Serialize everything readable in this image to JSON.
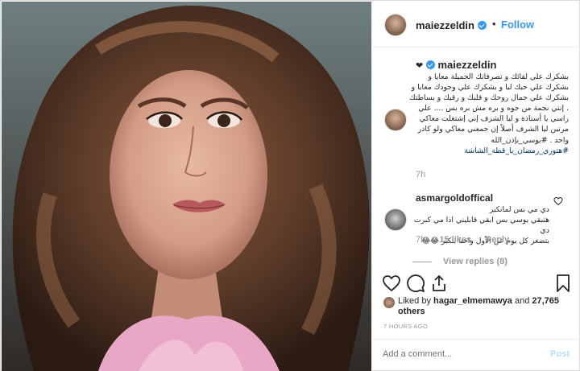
{
  "post": {
    "username": "maiezzeldin",
    "follow_label": "Follow",
    "separator": "•"
  },
  "caption": {
    "username": "maiezzeldin",
    "heart": "❤",
    "lines": [
      "بشكرك علي لقائك و تصرفاتك الجميلة معايا و",
      "بشكرك علي حبك ليا و بشكرك علي وجودك معايا و",
      "بشكرك علي جمال روحك و قلبك و رقيك و بساطتك",
      ". إنتي نجمة من جوه و بره مش بره بس .... علي",
      "راسي يا أستاذة و ليا الشرف إني إشتغلت معاكي",
      "مرتين ليا الشرف أصلاً إن جمعني معاكي ولو كادر",
      "واحد .  #يوسي_بإذن_الله"
    ],
    "hashtag_line": "#هتوري_رمضان_يا_قطة_الشاشة",
    "time": "7h"
  },
  "comment": {
    "username": "asmargoldoffical",
    "lines": [
      "دي مي بس لمانكير",
      "هتبقي يوسي بس ابقي قابليني اذا مي كبرت دي",
      "بتصغر كل يوم عن الأول واحنا بنكبر 😂😂"
    ],
    "time": "7h",
    "likes": "15 likes",
    "reply_label": "Reply",
    "view_replies": "View replies (8)"
  },
  "likes": {
    "prefix": "Liked by",
    "liker": "hagar_elmemawya",
    "joiner": "and",
    "others": "27,765 others"
  },
  "timestamp": "7 HOURS AGO",
  "add_comment": {
    "placeholder": "Add a comment...",
    "post_label": "Post"
  },
  "colors": {
    "accent": "#3897f0",
    "hashtag": "#003569",
    "muted": "#999999",
    "post_disabled": "#b2dffc"
  },
  "icons": [
    "heart-icon",
    "comment-icon",
    "share-icon",
    "bookmark-icon",
    "verified-icon"
  ]
}
